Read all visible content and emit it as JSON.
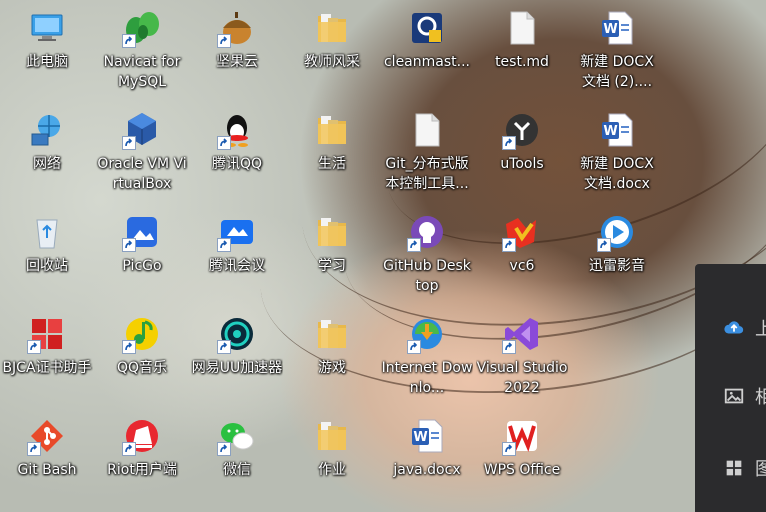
{
  "desktop": {
    "icons": [
      {
        "label": "此电脑",
        "icon": "this-pc-icon",
        "shortcut": false
      },
      {
        "label": "Navicat for MySQL",
        "icon": "navicat-icon",
        "shortcut": true
      },
      {
        "label": "坚果云",
        "icon": "jianguoyun-icon",
        "shortcut": true
      },
      {
        "label": "教师风采",
        "icon": "folder-icon",
        "shortcut": false
      },
      {
        "label": "cleanmast...",
        "icon": "cleanmaster-icon",
        "shortcut": false
      },
      {
        "label": "test.md",
        "icon": "file-icon",
        "shortcut": false
      },
      {
        "label": "新建 DOCX 文档 (2)....",
        "icon": "word-doc-icon",
        "shortcut": false
      },
      {
        "label": "网络",
        "icon": "network-icon",
        "shortcut": false
      },
      {
        "label": "Oracle VM VirtualBox",
        "icon": "virtualbox-icon",
        "shortcut": true
      },
      {
        "label": "腾讯QQ",
        "icon": "qq-icon",
        "shortcut": true
      },
      {
        "label": "生活",
        "icon": "folder-icon",
        "shortcut": false
      },
      {
        "label": "Git_分布式版本控制工具...",
        "icon": "file-icon",
        "shortcut": false
      },
      {
        "label": "uTools",
        "icon": "utools-icon",
        "shortcut": true
      },
      {
        "label": "新建 DOCX 文档.docx",
        "icon": "word-doc-icon",
        "shortcut": false
      },
      {
        "label": "回收站",
        "icon": "recycle-bin-icon",
        "shortcut": false
      },
      {
        "label": "PicGo",
        "icon": "picgo-icon",
        "shortcut": true
      },
      {
        "label": "腾讯会议",
        "icon": "tencent-meeting-icon",
        "shortcut": true
      },
      {
        "label": "学习",
        "icon": "folder-icon",
        "shortcut": false
      },
      {
        "label": "GitHub Desktop",
        "icon": "github-desktop-icon",
        "shortcut": true
      },
      {
        "label": "vc6",
        "icon": "vc6-icon",
        "shortcut": true
      },
      {
        "label": "迅雷影音",
        "icon": "xunlei-player-icon",
        "shortcut": true
      },
      {
        "label": "BJCA证书助手",
        "icon": "bjca-icon",
        "shortcut": true
      },
      {
        "label": "QQ音乐",
        "icon": "qq-music-icon",
        "shortcut": true
      },
      {
        "label": "网易UU加速器",
        "icon": "uu-accelerator-icon",
        "shortcut": true
      },
      {
        "label": "游戏",
        "icon": "folder-icon",
        "shortcut": false
      },
      {
        "label": "Internet Downlo...",
        "icon": "idm-icon",
        "shortcut": true
      },
      {
        "label": "Visual Studio 2022",
        "icon": "visual-studio-icon",
        "shortcut": true
      },
      {
        "label": "Git Bash",
        "icon": "git-bash-icon",
        "shortcut": true
      },
      {
        "label": "Riot用户端",
        "icon": "riot-client-icon",
        "shortcut": true
      },
      {
        "label": "微信",
        "icon": "wechat-icon",
        "shortcut": true
      },
      {
        "label": "作业",
        "icon": "folder-icon",
        "shortcut": false
      },
      {
        "label": "java.docx",
        "icon": "word-doc-icon",
        "shortcut": false
      },
      {
        "label": "WPS Office",
        "icon": "wps-icon",
        "shortcut": true
      }
    ]
  },
  "side_panel": {
    "items": [
      {
        "label": "上",
        "icon": "cloud-upload-icon"
      },
      {
        "label": "相",
        "icon": "image-icon"
      },
      {
        "label": "图",
        "icon": "grid-icon"
      }
    ]
  }
}
